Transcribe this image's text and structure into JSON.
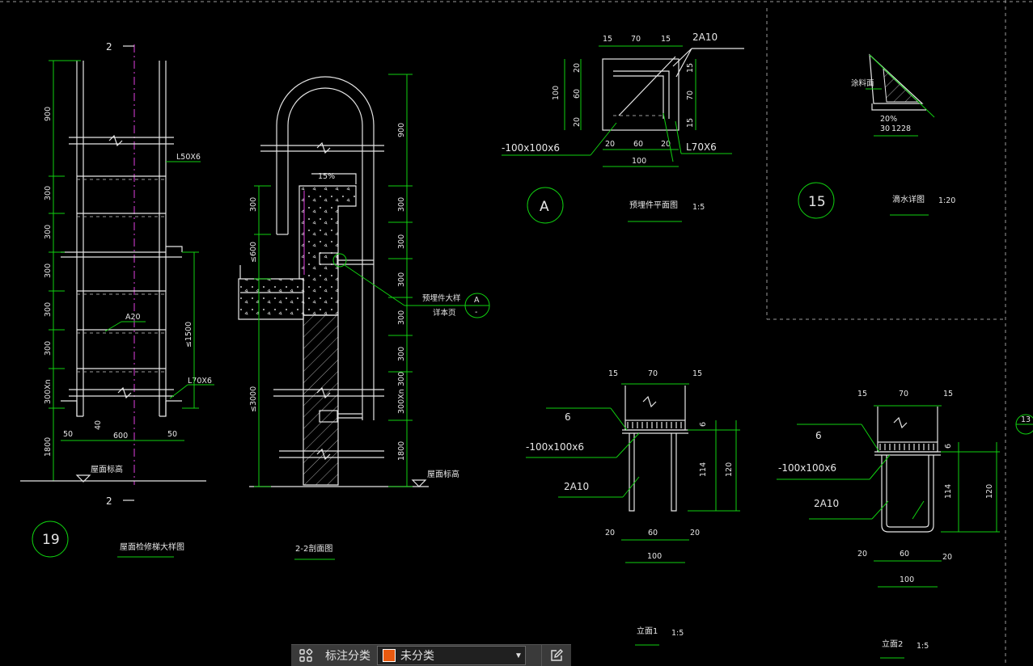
{
  "drawing": {
    "det19": {
      "section_top": "2",
      "section_bottom": "2",
      "dims_left": [
        "900",
        "300",
        "300",
        "300",
        "300",
        "300",
        "300Xn",
        "1800"
      ],
      "dim_bottom": [
        "50",
        "40",
        "600",
        "50"
      ],
      "label_angle": "L50X6",
      "label_rung": "A20",
      "label_l70": "L70X6",
      "dim_right": "≤1500",
      "level_label": "屋面标高",
      "bubble": "19",
      "title": "屋面检修梯大样图"
    },
    "sec22": {
      "dims_right": [
        "900",
        "300",
        "300",
        "300",
        "300",
        "300",
        "300",
        "300Xn",
        "1800"
      ],
      "dims_left": [
        "300",
        "≤600",
        "≤3000"
      ],
      "slope": "15%",
      "note_line1": "预埋件大样",
      "note_line2": "详本页",
      "bubble_ref": "A",
      "bubble_ref_sub": "-",
      "level_label": "屋面标高",
      "title": "2-2剖面图"
    },
    "detA": {
      "top_dims": [
        "15",
        "70",
        "15"
      ],
      "label_bars": "2A10",
      "left_dims": [
        "20",
        "60",
        "20"
      ],
      "left_total": "100",
      "right_dims": [
        "15",
        "70",
        "15"
      ],
      "bottom_dims": [
        "20",
        "60",
        "20"
      ],
      "bottom_total": "100",
      "label_plate": "-100x100x6",
      "label_angle": "L70X6",
      "bubble": "A",
      "title": "预埋件平面图",
      "scale": "1:5"
    },
    "det15": {
      "label_coat": "涂料面",
      "slope": "20%",
      "dims": [
        "30",
        "12",
        "28"
      ],
      "bubble": "15",
      "title": "滴水详图",
      "scale": "1:20"
    },
    "elev1": {
      "top_dims": [
        "15",
        "70",
        "15"
      ],
      "weld": "6",
      "label_plate": "-100x100x6",
      "label_bars": "2A10",
      "right_dims": [
        "6",
        "114",
        "120"
      ],
      "bottom_dims": [
        "20",
        "60",
        "20"
      ],
      "bottom_total": "100",
      "title": "立面1",
      "scale": "1:5"
    },
    "elev2": {
      "top_dims": [
        "15",
        "70",
        "15"
      ],
      "weld": "6",
      "label_plate": "-100x100x6",
      "label_bars": "2A10",
      "right_dims": [
        "6",
        "114",
        "120"
      ],
      "bottom_dims": [
        "20",
        "60",
        "20"
      ],
      "bottom_total": "100",
      "title": "立面2",
      "scale": "1:5"
    },
    "edge_bubble": "13"
  },
  "toolbar": {
    "icon": "grid-icon",
    "label": "标注分类",
    "selected_value": "未分类",
    "swatch_color": "#e85a10",
    "edit_icon": "edit-icon"
  }
}
